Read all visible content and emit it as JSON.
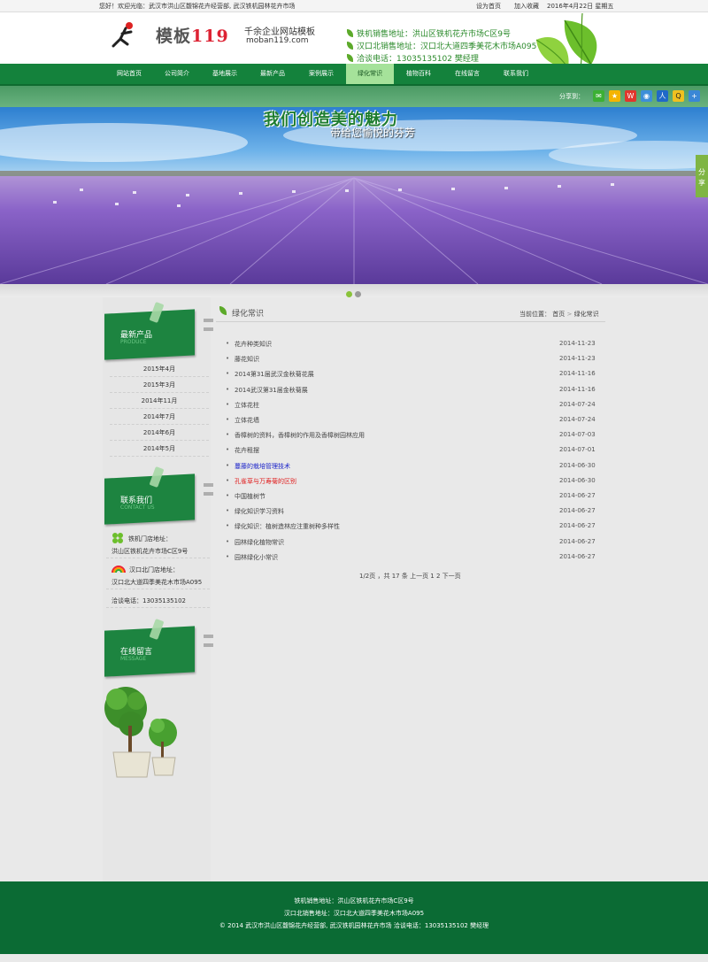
{
  "topbar": {
    "welcome": "您好！欢迎光临：武汉市洪山区馥锦花卉经营部, 武汉铁机园林花卉市场",
    "set_home": "设为首页",
    "favorite": "加入收藏",
    "date": "2016年4月22日 星期五"
  },
  "header": {
    "logo_text_cn": "模板",
    "logo_text_num": "119",
    "slogan_main": "千余企业网站模板",
    "slogan_url": "moban119.com",
    "info": [
      "铁机销售地址：洪山区铁机花卉市场C区9号",
      "汉口北销售地址：汉口北大道四季美花木市场A095",
      "洽谈电话：13035135102    樊经理"
    ]
  },
  "nav": {
    "items": [
      "网站首页",
      "公司简介",
      "基地展示",
      "最新产品",
      "案例展示",
      "绿化常识",
      "植物百科",
      "在线留言",
      "联系我们"
    ],
    "active_index": 5
  },
  "share": {
    "label": "分享到：",
    "side_label": "分享"
  },
  "banner": {
    "title": "我们创造美的魅力",
    "subtitle": "带给您愉悦的芬芳"
  },
  "sidebar": {
    "products": {
      "title": "最新产品",
      "subtitle": "PRODUCE",
      "items": [
        "2015年4月",
        "2015年3月",
        "2014年11月",
        "2014年7月",
        "2014年6月",
        "2014年5月"
      ]
    },
    "contact": {
      "title": "联系我们",
      "subtitle": "CONTACT US",
      "shop1_label": "铁机门店地址：",
      "shop1_addr": "洪山区铁机花卉市场C区9号",
      "shop2_label": "汉口北门店地址：",
      "shop2_addr": "汉口北大道四季美花木市场A095",
      "phone": "洽谈电话：13035135102"
    },
    "message": {
      "title": "在线留言",
      "subtitle": "MESSAGE"
    }
  },
  "main": {
    "title": "绿化常识",
    "breadcrumb_prefix": "当前位置：",
    "breadcrumb_home": "首页",
    "breadcrumb_sep": ">",
    "breadcrumb_current": "绿化常识",
    "articles": [
      {
        "title": "花卉种类知识",
        "date": "2014-11-23",
        "color": "#444444"
      },
      {
        "title": "藤花知识",
        "date": "2014-11-23",
        "color": "#444444"
      },
      {
        "title": "2014第31届武汉金秋菊花展",
        "date": "2014-11-16",
        "color": "#444444"
      },
      {
        "title": "2014武汉第31届金秋菊展",
        "date": "2014-11-16",
        "color": "#444444"
      },
      {
        "title": "立体花柱",
        "date": "2014-07-24",
        "color": "#444444"
      },
      {
        "title": "立体花墙",
        "date": "2014-07-24",
        "color": "#444444"
      },
      {
        "title": "香樟树的资料，香樟树的作用及香樟树园林应用",
        "date": "2014-07-03",
        "color": "#444444"
      },
      {
        "title": "花卉租摆",
        "date": "2014-07-01",
        "color": "#444444"
      },
      {
        "title": "蔓藤的栽培管理技术",
        "date": "2014-06-30",
        "color": "#1a22c9"
      },
      {
        "title": "孔雀草与万寿菊的区别",
        "date": "2014-06-30",
        "color": "#e01b1b"
      },
      {
        "title": "中国植树节",
        "date": "2014-06-27",
        "color": "#444444"
      },
      {
        "title": "绿化知识学习资料",
        "date": "2014-06-27",
        "color": "#444444"
      },
      {
        "title": "绿化知识：植树造林应注重树种多样性",
        "date": "2014-06-27",
        "color": "#444444"
      },
      {
        "title": "园林绿化植物常识",
        "date": "2014-06-27",
        "color": "#444444"
      },
      {
        "title": "园林绿化小常识",
        "date": "2014-06-27",
        "color": "#444444"
      }
    ],
    "pager": "1/2页 ，共 17 条  上一页 1 2 下一页"
  },
  "footer": {
    "line1": "铁机销售地址：洪山区铁机花卉市场C区9号",
    "line2": "汉口北销售地址：汉口北大道四季美花木市场A095",
    "line3": "©  2014 武汉市洪山区馥锦花卉经营部, 武汉铁机园林花卉市场  洽谈电话：13035135102  樊经理"
  },
  "colors": {
    "brand_green": "#14823c",
    "footer_green": "#0b6b34",
    "active_nav": "#a5e29a"
  }
}
